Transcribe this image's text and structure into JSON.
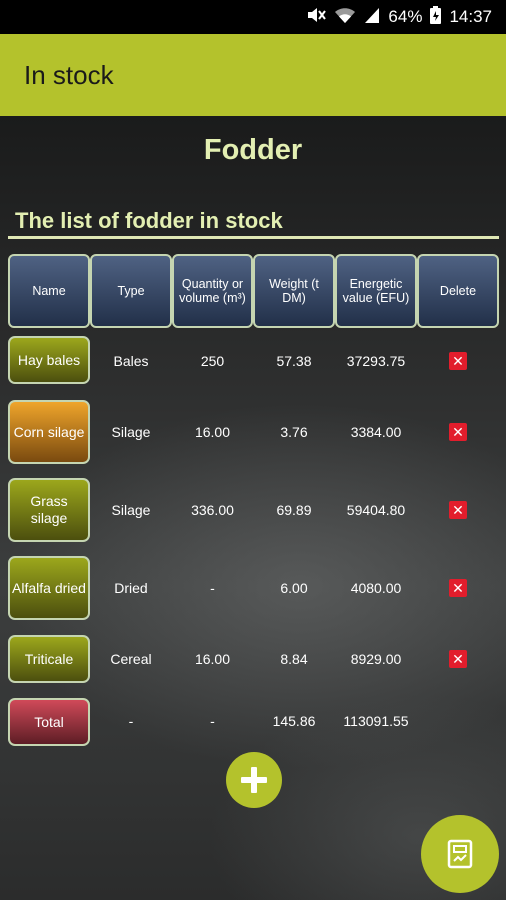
{
  "status_bar": {
    "battery": "64%",
    "time": "14:37"
  },
  "app_bar": {
    "title": "In stock"
  },
  "page": {
    "section_title": "Fodder",
    "list_title": "The list of fodder in stock"
  },
  "table": {
    "headers": [
      "Name",
      "Type",
      "Quantity or volume (m³)",
      "Weight (t DM)",
      "Energetic value (EFU)",
      "Delete"
    ],
    "rows": [
      {
        "name": "Hay bales",
        "type": "Bales",
        "quantity": "250",
        "weight": "57.38",
        "energy": "37293.75"
      },
      {
        "name": "Corn silage",
        "type": "Silage",
        "quantity": "16.00",
        "weight": "3.76",
        "energy": "3384.00"
      },
      {
        "name": "Grass silage",
        "type": "Silage",
        "quantity": "336.00",
        "weight": "69.89",
        "energy": "59404.80"
      },
      {
        "name": "Alfalfa dried",
        "type": "Dried",
        "quantity": "-",
        "weight": "6.00",
        "energy": "4080.00"
      },
      {
        "name": "Triticale",
        "type": "Cereal",
        "quantity": "16.00",
        "weight": "8.84",
        "energy": "8929.00"
      }
    ],
    "total": {
      "name": "Total",
      "type": "-",
      "quantity": "-",
      "weight": "145.86",
      "energy": "113091.55"
    }
  },
  "icons": {
    "delete": "close-icon",
    "add": "plus-icon",
    "calculate": "calculator-icon"
  },
  "colors": {
    "accent": "#b4c22c",
    "header_text": "#e3efb2",
    "delete": "#e21d2c"
  }
}
